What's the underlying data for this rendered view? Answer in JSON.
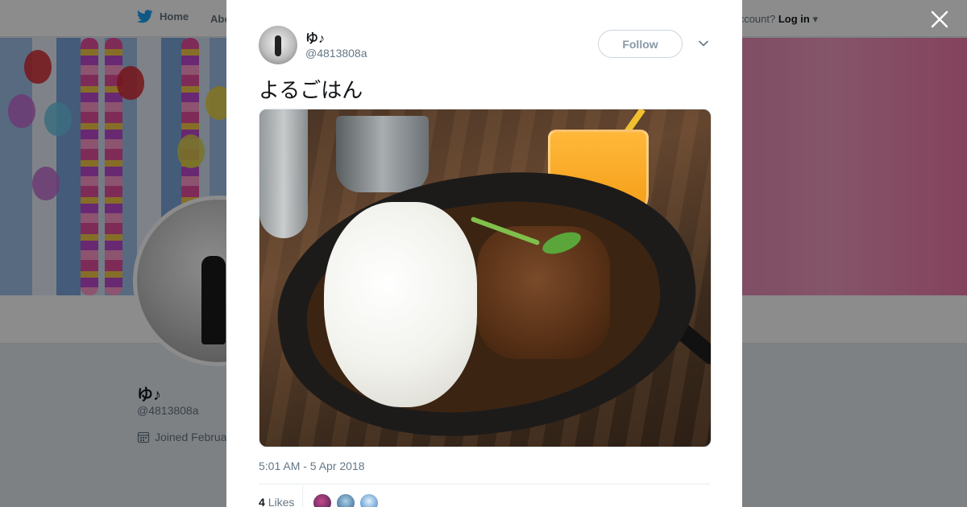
{
  "background_page": {
    "nav": {
      "home_label": "Home",
      "about_label": "Abo",
      "account_prompt": "ccount?",
      "login_label": "Log in"
    },
    "profile": {
      "name": "ゆ♪",
      "handle": "@4813808a",
      "joined": "Joined Februa"
    }
  },
  "tweet": {
    "author_name": "ゆ♪",
    "author_handle": "@4813808a",
    "follow_label": "Follow",
    "text": "よるごはん",
    "timestamp": "5:01 AM - 5 Apr 2018",
    "likes_count": "4",
    "likes_label": "Likes"
  },
  "icons": {
    "close": "close-icon",
    "caret": "chevron-down-icon",
    "twitter": "twitter-bird-icon",
    "calendar": "calendar-icon"
  },
  "colors": {
    "brand_blue": "#1da1f2",
    "text_primary": "#14171a",
    "text_secondary": "#657786",
    "overlay": "rgba(0,0,0,0.45)"
  }
}
